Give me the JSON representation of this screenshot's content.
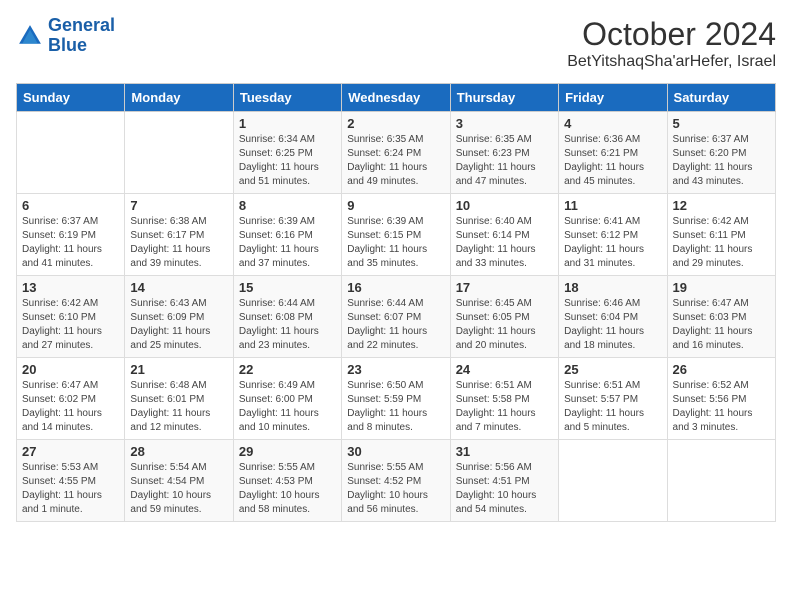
{
  "logo": {
    "line1": "General",
    "line2": "Blue"
  },
  "title": "October 2024",
  "location": "BetYitshaqSha'arHefer, Israel",
  "days_header": [
    "Sunday",
    "Monday",
    "Tuesday",
    "Wednesday",
    "Thursday",
    "Friday",
    "Saturday"
  ],
  "weeks": [
    [
      {
        "day": "",
        "info": ""
      },
      {
        "day": "",
        "info": ""
      },
      {
        "day": "1",
        "info": "Sunrise: 6:34 AM\nSunset: 6:25 PM\nDaylight: 11 hours and 51 minutes."
      },
      {
        "day": "2",
        "info": "Sunrise: 6:35 AM\nSunset: 6:24 PM\nDaylight: 11 hours and 49 minutes."
      },
      {
        "day": "3",
        "info": "Sunrise: 6:35 AM\nSunset: 6:23 PM\nDaylight: 11 hours and 47 minutes."
      },
      {
        "day": "4",
        "info": "Sunrise: 6:36 AM\nSunset: 6:21 PM\nDaylight: 11 hours and 45 minutes."
      },
      {
        "day": "5",
        "info": "Sunrise: 6:37 AM\nSunset: 6:20 PM\nDaylight: 11 hours and 43 minutes."
      }
    ],
    [
      {
        "day": "6",
        "info": "Sunrise: 6:37 AM\nSunset: 6:19 PM\nDaylight: 11 hours and 41 minutes."
      },
      {
        "day": "7",
        "info": "Sunrise: 6:38 AM\nSunset: 6:17 PM\nDaylight: 11 hours and 39 minutes."
      },
      {
        "day": "8",
        "info": "Sunrise: 6:39 AM\nSunset: 6:16 PM\nDaylight: 11 hours and 37 minutes."
      },
      {
        "day": "9",
        "info": "Sunrise: 6:39 AM\nSunset: 6:15 PM\nDaylight: 11 hours and 35 minutes."
      },
      {
        "day": "10",
        "info": "Sunrise: 6:40 AM\nSunset: 6:14 PM\nDaylight: 11 hours and 33 minutes."
      },
      {
        "day": "11",
        "info": "Sunrise: 6:41 AM\nSunset: 6:12 PM\nDaylight: 11 hours and 31 minutes."
      },
      {
        "day": "12",
        "info": "Sunrise: 6:42 AM\nSunset: 6:11 PM\nDaylight: 11 hours and 29 minutes."
      }
    ],
    [
      {
        "day": "13",
        "info": "Sunrise: 6:42 AM\nSunset: 6:10 PM\nDaylight: 11 hours and 27 minutes."
      },
      {
        "day": "14",
        "info": "Sunrise: 6:43 AM\nSunset: 6:09 PM\nDaylight: 11 hours and 25 minutes."
      },
      {
        "day": "15",
        "info": "Sunrise: 6:44 AM\nSunset: 6:08 PM\nDaylight: 11 hours and 23 minutes."
      },
      {
        "day": "16",
        "info": "Sunrise: 6:44 AM\nSunset: 6:07 PM\nDaylight: 11 hours and 22 minutes."
      },
      {
        "day": "17",
        "info": "Sunrise: 6:45 AM\nSunset: 6:05 PM\nDaylight: 11 hours and 20 minutes."
      },
      {
        "day": "18",
        "info": "Sunrise: 6:46 AM\nSunset: 6:04 PM\nDaylight: 11 hours and 18 minutes."
      },
      {
        "day": "19",
        "info": "Sunrise: 6:47 AM\nSunset: 6:03 PM\nDaylight: 11 hours and 16 minutes."
      }
    ],
    [
      {
        "day": "20",
        "info": "Sunrise: 6:47 AM\nSunset: 6:02 PM\nDaylight: 11 hours and 14 minutes."
      },
      {
        "day": "21",
        "info": "Sunrise: 6:48 AM\nSunset: 6:01 PM\nDaylight: 11 hours and 12 minutes."
      },
      {
        "day": "22",
        "info": "Sunrise: 6:49 AM\nSunset: 6:00 PM\nDaylight: 11 hours and 10 minutes."
      },
      {
        "day": "23",
        "info": "Sunrise: 6:50 AM\nSunset: 5:59 PM\nDaylight: 11 hours and 8 minutes."
      },
      {
        "day": "24",
        "info": "Sunrise: 6:51 AM\nSunset: 5:58 PM\nDaylight: 11 hours and 7 minutes."
      },
      {
        "day": "25",
        "info": "Sunrise: 6:51 AM\nSunset: 5:57 PM\nDaylight: 11 hours and 5 minutes."
      },
      {
        "day": "26",
        "info": "Sunrise: 6:52 AM\nSunset: 5:56 PM\nDaylight: 11 hours and 3 minutes."
      }
    ],
    [
      {
        "day": "27",
        "info": "Sunrise: 5:53 AM\nSunset: 4:55 PM\nDaylight: 11 hours and 1 minute."
      },
      {
        "day": "28",
        "info": "Sunrise: 5:54 AM\nSunset: 4:54 PM\nDaylight: 10 hours and 59 minutes."
      },
      {
        "day": "29",
        "info": "Sunrise: 5:55 AM\nSunset: 4:53 PM\nDaylight: 10 hours and 58 minutes."
      },
      {
        "day": "30",
        "info": "Sunrise: 5:55 AM\nSunset: 4:52 PM\nDaylight: 10 hours and 56 minutes."
      },
      {
        "day": "31",
        "info": "Sunrise: 5:56 AM\nSunset: 4:51 PM\nDaylight: 10 hours and 54 minutes."
      },
      {
        "day": "",
        "info": ""
      },
      {
        "day": "",
        "info": ""
      }
    ]
  ]
}
